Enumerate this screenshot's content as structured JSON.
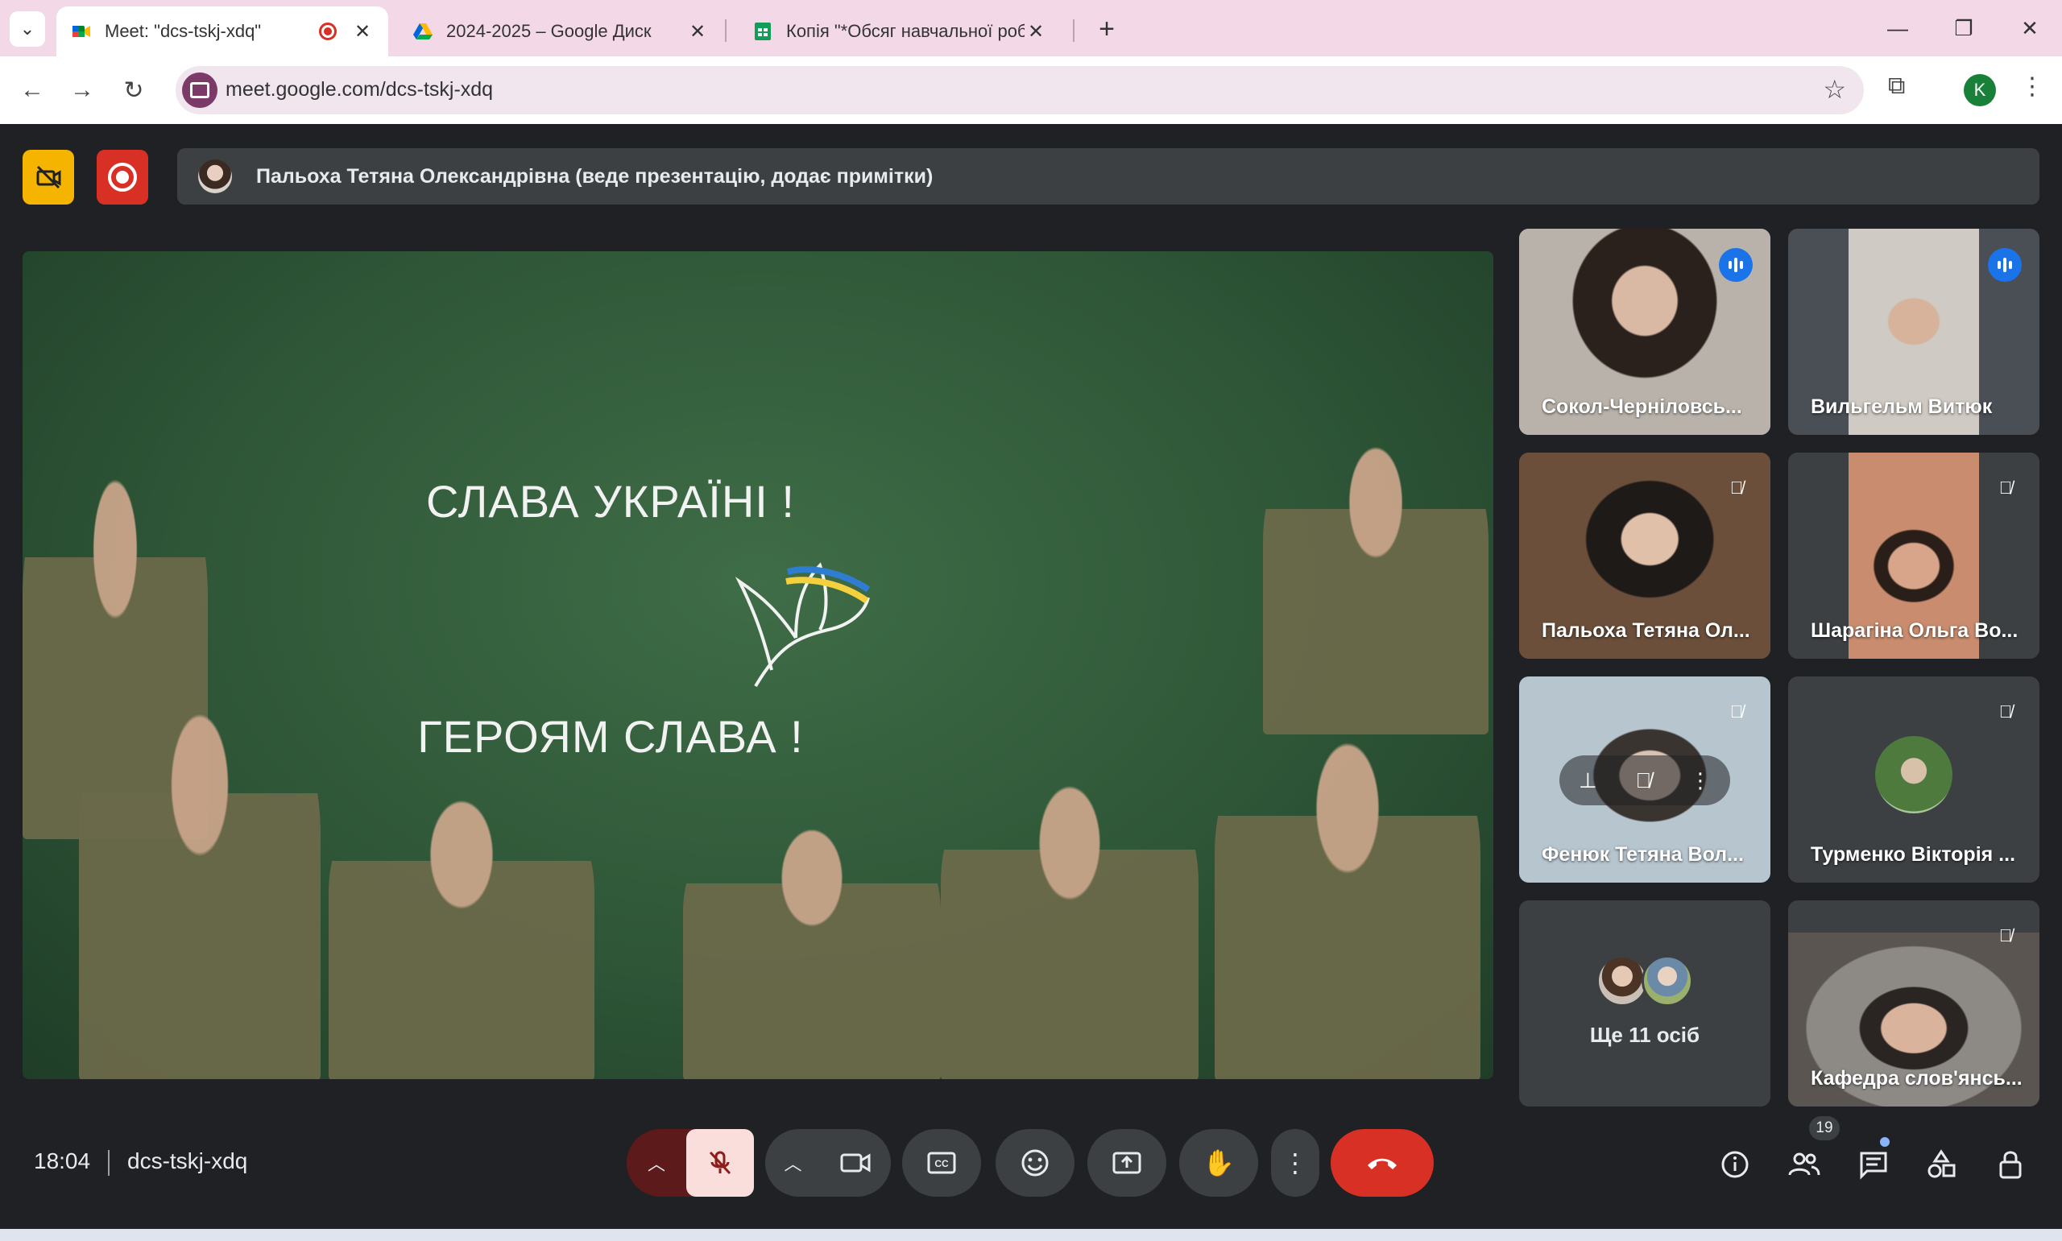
{
  "browser": {
    "tabs": [
      {
        "title": "Meet: \"dcs-tskj-xdq\"",
        "active": true
      },
      {
        "title": "2024-2025 – Google Диск",
        "active": false
      },
      {
        "title": "Копія \"*Обсяг навчальної роб",
        "active": false
      }
    ],
    "url": "meet.google.com/dcs-tskj-xdq",
    "profile_initial": "K"
  },
  "meet": {
    "presenter_banner": "Пальоха Тетяна Олександрівна (веде презентацію, додає примітки)",
    "slide": {
      "top_text": "СЛАВА УКРАЇНІ !",
      "bottom_text": "ГЕРОЯМ СЛАВА !"
    },
    "participants": [
      {
        "name": "Сокол-Черніловсь...",
        "state": "speaking"
      },
      {
        "name": "Вильгельм Витюк",
        "state": "speaking"
      },
      {
        "name": "Пальоха Тетяна Ол...",
        "state": "muted"
      },
      {
        "name": "Шарагіна Ольга Во...",
        "state": "muted"
      },
      {
        "name": "Фенюк Тетяна Вол...",
        "state": "muted"
      },
      {
        "name": "Турменко Вікторія ...",
        "state": "muted"
      },
      {
        "name": "Кафедра слов'янсь...",
        "state": "muted"
      }
    ],
    "more_people_label": "Ще 11 осіб",
    "time": "18:04",
    "meeting_code": "dcs-tskj-xdq",
    "people_count": "19",
    "colors": {
      "end_call": "#d93025",
      "speaker_ring": "#8ab4f8",
      "rec": "#d93025",
      "nocam_badge": "#f4b400"
    }
  },
  "icons": [
    "chevron-down-icon",
    "meet-favicon",
    "drive-favicon",
    "sheets-favicon",
    "recording-icon",
    "close-icon",
    "plus-icon",
    "minimize-icon",
    "restore-icon",
    "back-arrow-icon",
    "forward-arrow-icon",
    "reload-icon",
    "star-icon",
    "extensions-icon",
    "menu-icon",
    "camera-off-icon",
    "mic-off-icon",
    "camera-icon",
    "captions-icon",
    "emoji-icon",
    "present-icon",
    "raise-hand-icon",
    "more-vert-icon",
    "end-call-icon",
    "info-icon",
    "people-icon",
    "chat-icon",
    "activities-icon",
    "host-controls-icon",
    "pin-icon"
  ]
}
